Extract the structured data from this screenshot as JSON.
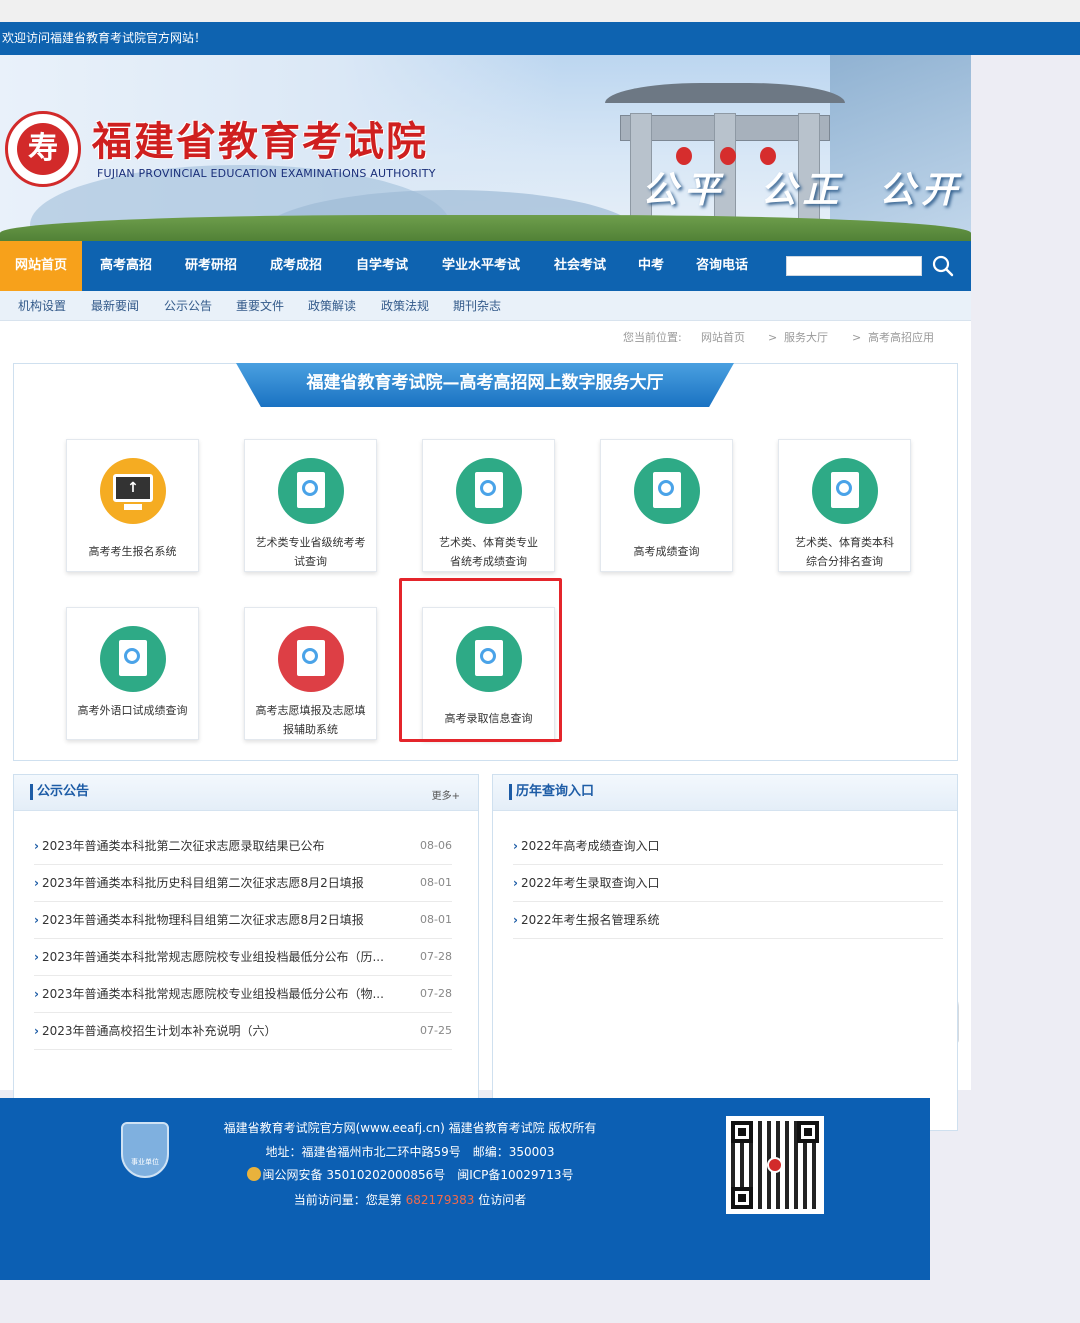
{
  "welcome": "欢迎访问福建省教育考试院官方网站！",
  "header": {
    "seal_char": "寿",
    "title_cn": "福建省教育考试院",
    "title_en": "FUJIAN PROVINCIAL EDUCATION EXAMINATIONS AUTHORITY",
    "slogan": "公平 公正 公开"
  },
  "nav": {
    "items": [
      "网站首页",
      "高考高招",
      "研考研招",
      "成考成招",
      "自学考试",
      "学业水平考试",
      "社会考试",
      "中考",
      "咨询电话"
    ],
    "active_index": 0,
    "search_placeholder": ""
  },
  "subnav": [
    "机构设置",
    "最新要闻",
    "公示公告",
    "重要文件",
    "政策解读",
    "政策法规",
    "期刊杂志"
  ],
  "breadcrumb": {
    "prefix": "您当前位置:",
    "items": [
      "网站首页",
      "服务大厅",
      "高考高招应用"
    ],
    "separator": ">"
  },
  "hall": {
    "title": "福建省教育考试院—高考高招网上数字服务大厅",
    "cards": [
      {
        "line1": "高考考生报名系统",
        "line2": "",
        "icon": "computer-upload-icon"
      },
      {
        "line1": "艺术类专业省级统考考",
        "line2": "试查询",
        "icon": "score-sheet-icon"
      },
      {
        "line1": "艺术类、体育类专业",
        "line2": "省统考成绩查询",
        "icon": "score-sheet-icon"
      },
      {
        "line1": "高考成绩查询",
        "line2": "",
        "icon": "score-sheet-icon"
      },
      {
        "line1": "艺术类、体育类本科",
        "line2": "综合分排名查询",
        "icon": "score-sheet-icon"
      },
      {
        "line1": "高考外语口试成绩查询",
        "line2": "",
        "icon": "score-sheet-icon"
      },
      {
        "line1": "高考志愿填报及志愿填",
        "line2": "报辅助系统",
        "icon": "checklist-pencil-icon"
      },
      {
        "line1": "高考录取信息查询",
        "line2": "",
        "icon": "score-sheet-icon"
      }
    ]
  },
  "notices": {
    "title": "公示公告",
    "more": "更多+",
    "items": [
      {
        "text": "2023年普通类本科批第二次征求志愿录取结果已公布",
        "date": "08-06"
      },
      {
        "text": "2023年普通类本科批历史科目组第二次征求志愿8月2日填报",
        "date": "08-01"
      },
      {
        "text": "2023年普通类本科批物理科目组第二次征求志愿8月2日填报",
        "date": "08-01"
      },
      {
        "text": "2023年普通类本科批常规志愿院校专业组投档最低分公布（历...",
        "date": "07-28"
      },
      {
        "text": "2023年普通类本科批常规志愿院校专业组投档最低分公布（物...",
        "date": "07-28"
      },
      {
        "text": "2023年普通高校招生计划本补充说明（六）",
        "date": "07-25"
      }
    ]
  },
  "history": {
    "title": "历年查询入口",
    "items": [
      "2022年高考成绩查询入口",
      "2022年考生录取查询入口",
      "2022年考生报名管理系统"
    ]
  },
  "footer": {
    "badge": "事业单位",
    "copyright": "福建省教育考试院官方网(www.eeafj.cn) 福建省教育考试院 版权所有",
    "address": "地址：福建省福州市北二环中路59号　邮编：350003",
    "icp": "闽公网安备 35010202000856号　闽ICP备10029713号",
    "visits_prefix": "当前访问量：您是第",
    "visits_count": "682179383",
    "visits_suffix": "位访问者"
  },
  "colors": {
    "nav_blue": "#0e63b0",
    "nav_active": "#f7a11b",
    "highlight_red": "#e4252b",
    "icon_green": "#2eaa86"
  }
}
